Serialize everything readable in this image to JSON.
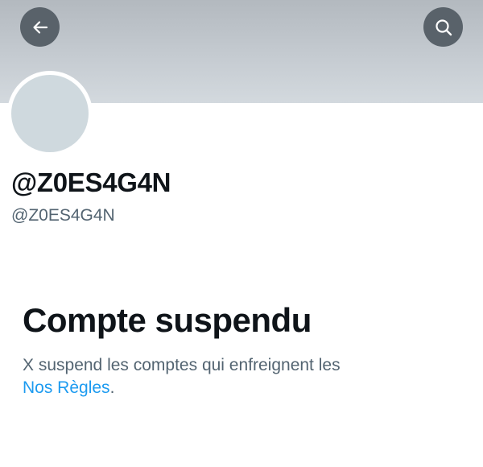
{
  "header": {
    "back_icon": "arrow-left-icon",
    "search_icon": "search-icon",
    "banner_color": "#c5cbd1",
    "button_color": "#59626a"
  },
  "profile": {
    "display_name": "@Z0ES4G4N",
    "handle": "@Z0ES4G4N",
    "avatar_color": "#cfd9de"
  },
  "suspension": {
    "title": "Compte suspendu",
    "message": "X suspend les comptes qui enfreignent les",
    "rules_link": "Nos Règles",
    "trailing": "."
  },
  "colors": {
    "text_primary": "#0f1419",
    "text_secondary": "#536471",
    "link": "#1d9bf0"
  }
}
